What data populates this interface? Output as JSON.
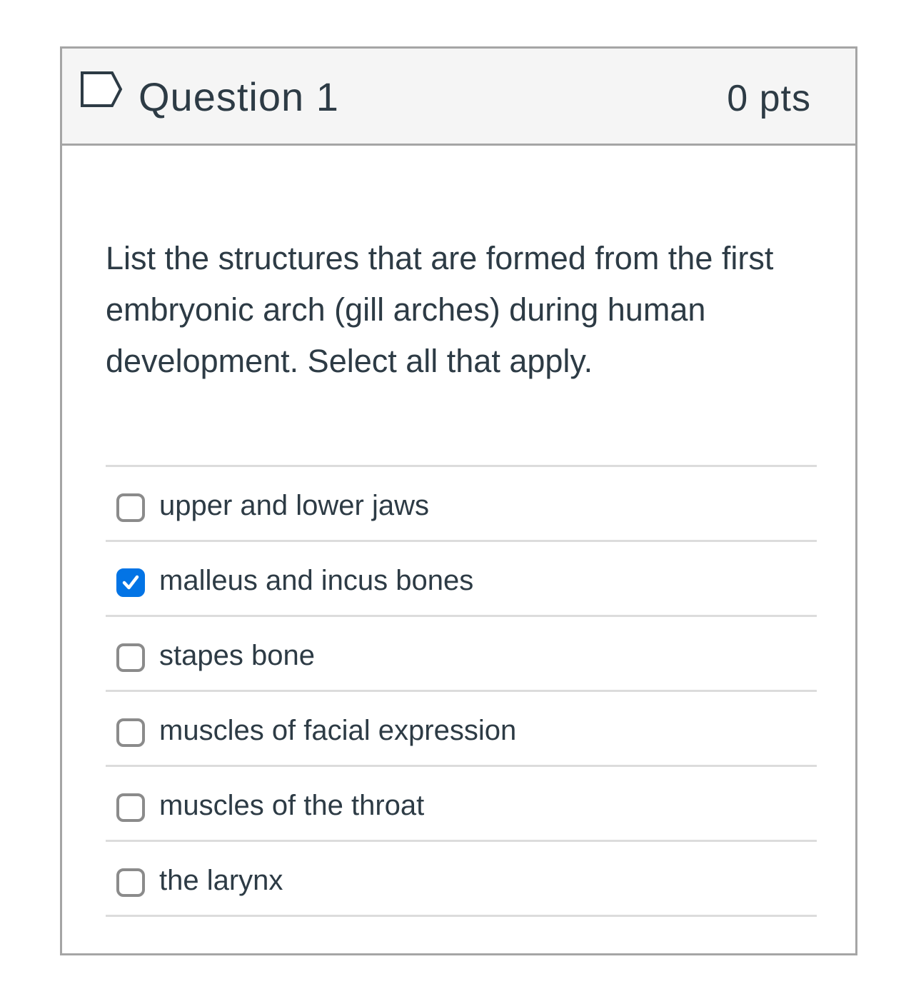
{
  "question": {
    "title": "Question 1",
    "points": "0 pts",
    "flag_icon": "flag-icon",
    "text": "List the structures that are formed from the first embryonic arch (gill arches) during human development. Select all that apply."
  },
  "answers": [
    {
      "label": "upper and lower jaws",
      "checked": false
    },
    {
      "label": "malleus and incus bones",
      "checked": true
    },
    {
      "label": "stapes bone",
      "checked": false
    },
    {
      "label": "muscles of facial expression",
      "checked": false
    },
    {
      "label": "muscles of the throat",
      "checked": false
    },
    {
      "label": "the larynx",
      "checked": false
    }
  ],
  "colors": {
    "accent": "#0374e5",
    "text": "#2d3b45",
    "border": "#a5a5a5",
    "header_bg": "#f5f5f5"
  }
}
